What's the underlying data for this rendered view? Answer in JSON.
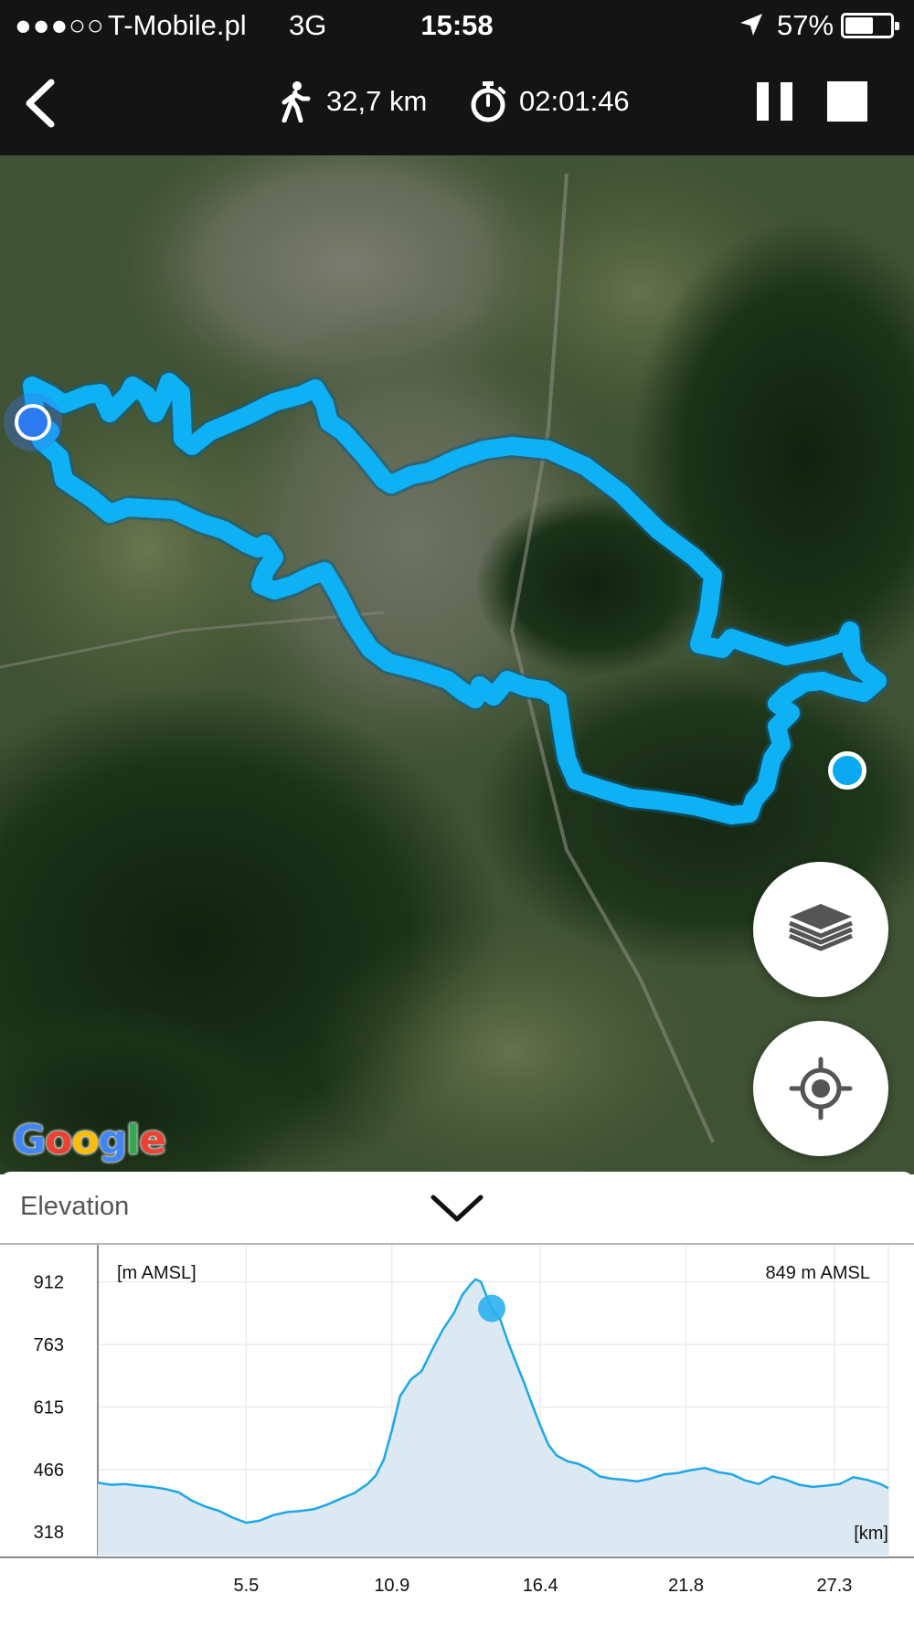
{
  "status_bar": {
    "signal": "●●●○○",
    "carrier": "T-Mobile.pl",
    "network": "3G",
    "time": "15:58",
    "battery_percent": "57%"
  },
  "toolbar": {
    "distance": "32,7 km",
    "duration": "02:01:46",
    "icons": {
      "back": "chevron-left-icon",
      "distance": "walking-person-icon",
      "duration": "stopwatch-icon",
      "pause": "pause-icon",
      "stop": "stop-icon"
    }
  },
  "map": {
    "route_color": "#0fb1f5",
    "attribution": "Google",
    "buttons": {
      "layers": "layers-icon",
      "locate": "crosshair-icon"
    }
  },
  "elevation_panel": {
    "title": "Elevation",
    "collapse_icon": "chevron-down-icon"
  },
  "chart_data": {
    "type": "area",
    "ylabel": "[m AMSL]",
    "xlabel": "[km]",
    "current_value_label": "849 m AMSL",
    "y_ticks": [
      912,
      763,
      615,
      466,
      318
    ],
    "x_ticks": [
      5.5,
      10.9,
      16.4,
      21.8,
      27.3
    ],
    "xlim": [
      0,
      29.3
    ],
    "ylim": [
      262,
      1000
    ],
    "marker": {
      "x": 14.6,
      "y": 849
    },
    "grid": true,
    "color": "#1ca7e8",
    "fill_color": "#dce9f2",
    "series": [
      {
        "x": [
          0,
          0.5,
          1.0,
          1.5,
          2.0,
          2.5,
          3.0,
          3.5,
          4.0,
          4.5,
          5.0,
          5.5,
          6.0,
          6.5,
          7.0,
          7.5,
          8.0,
          8.5,
          9.0,
          9.5,
          10.0,
          10.3,
          10.6,
          10.9,
          11.2,
          11.6,
          12.0,
          12.4,
          12.8,
          13.2,
          13.5,
          13.8,
          14.0,
          14.2,
          14.4,
          14.6,
          14.9,
          15.2,
          15.5,
          15.8,
          16.1,
          16.4,
          16.7,
          17.0,
          17.4,
          17.8,
          18.2,
          18.6,
          19.0,
          19.5,
          20.0,
          20.5,
          21.0,
          21.5,
          22.0,
          22.5,
          23.0,
          23.5,
          24.0,
          24.5,
          25.0,
          25.5,
          26.0,
          26.5,
          27.0,
          27.5,
          28.0,
          28.5,
          29.0,
          29.3
        ],
        "y": [
          435,
          430,
          432,
          428,
          425,
          420,
          412,
          392,
          378,
          368,
          352,
          340,
          345,
          358,
          365,
          368,
          372,
          383,
          397,
          410,
          432,
          452,
          490,
          560,
          640,
          680,
          700,
          752,
          800,
          838,
          880,
          905,
          918,
          912,
          880,
          849,
          826,
          770,
          720,
          672,
          620,
          570,
          525,
          500,
          486,
          480,
          468,
          450,
          445,
          442,
          438,
          445,
          455,
          458,
          465,
          470,
          460,
          455,
          440,
          432,
          450,
          442,
          430,
          425,
          428,
          432,
          448,
          442,
          432,
          422
        ]
      }
    ]
  }
}
